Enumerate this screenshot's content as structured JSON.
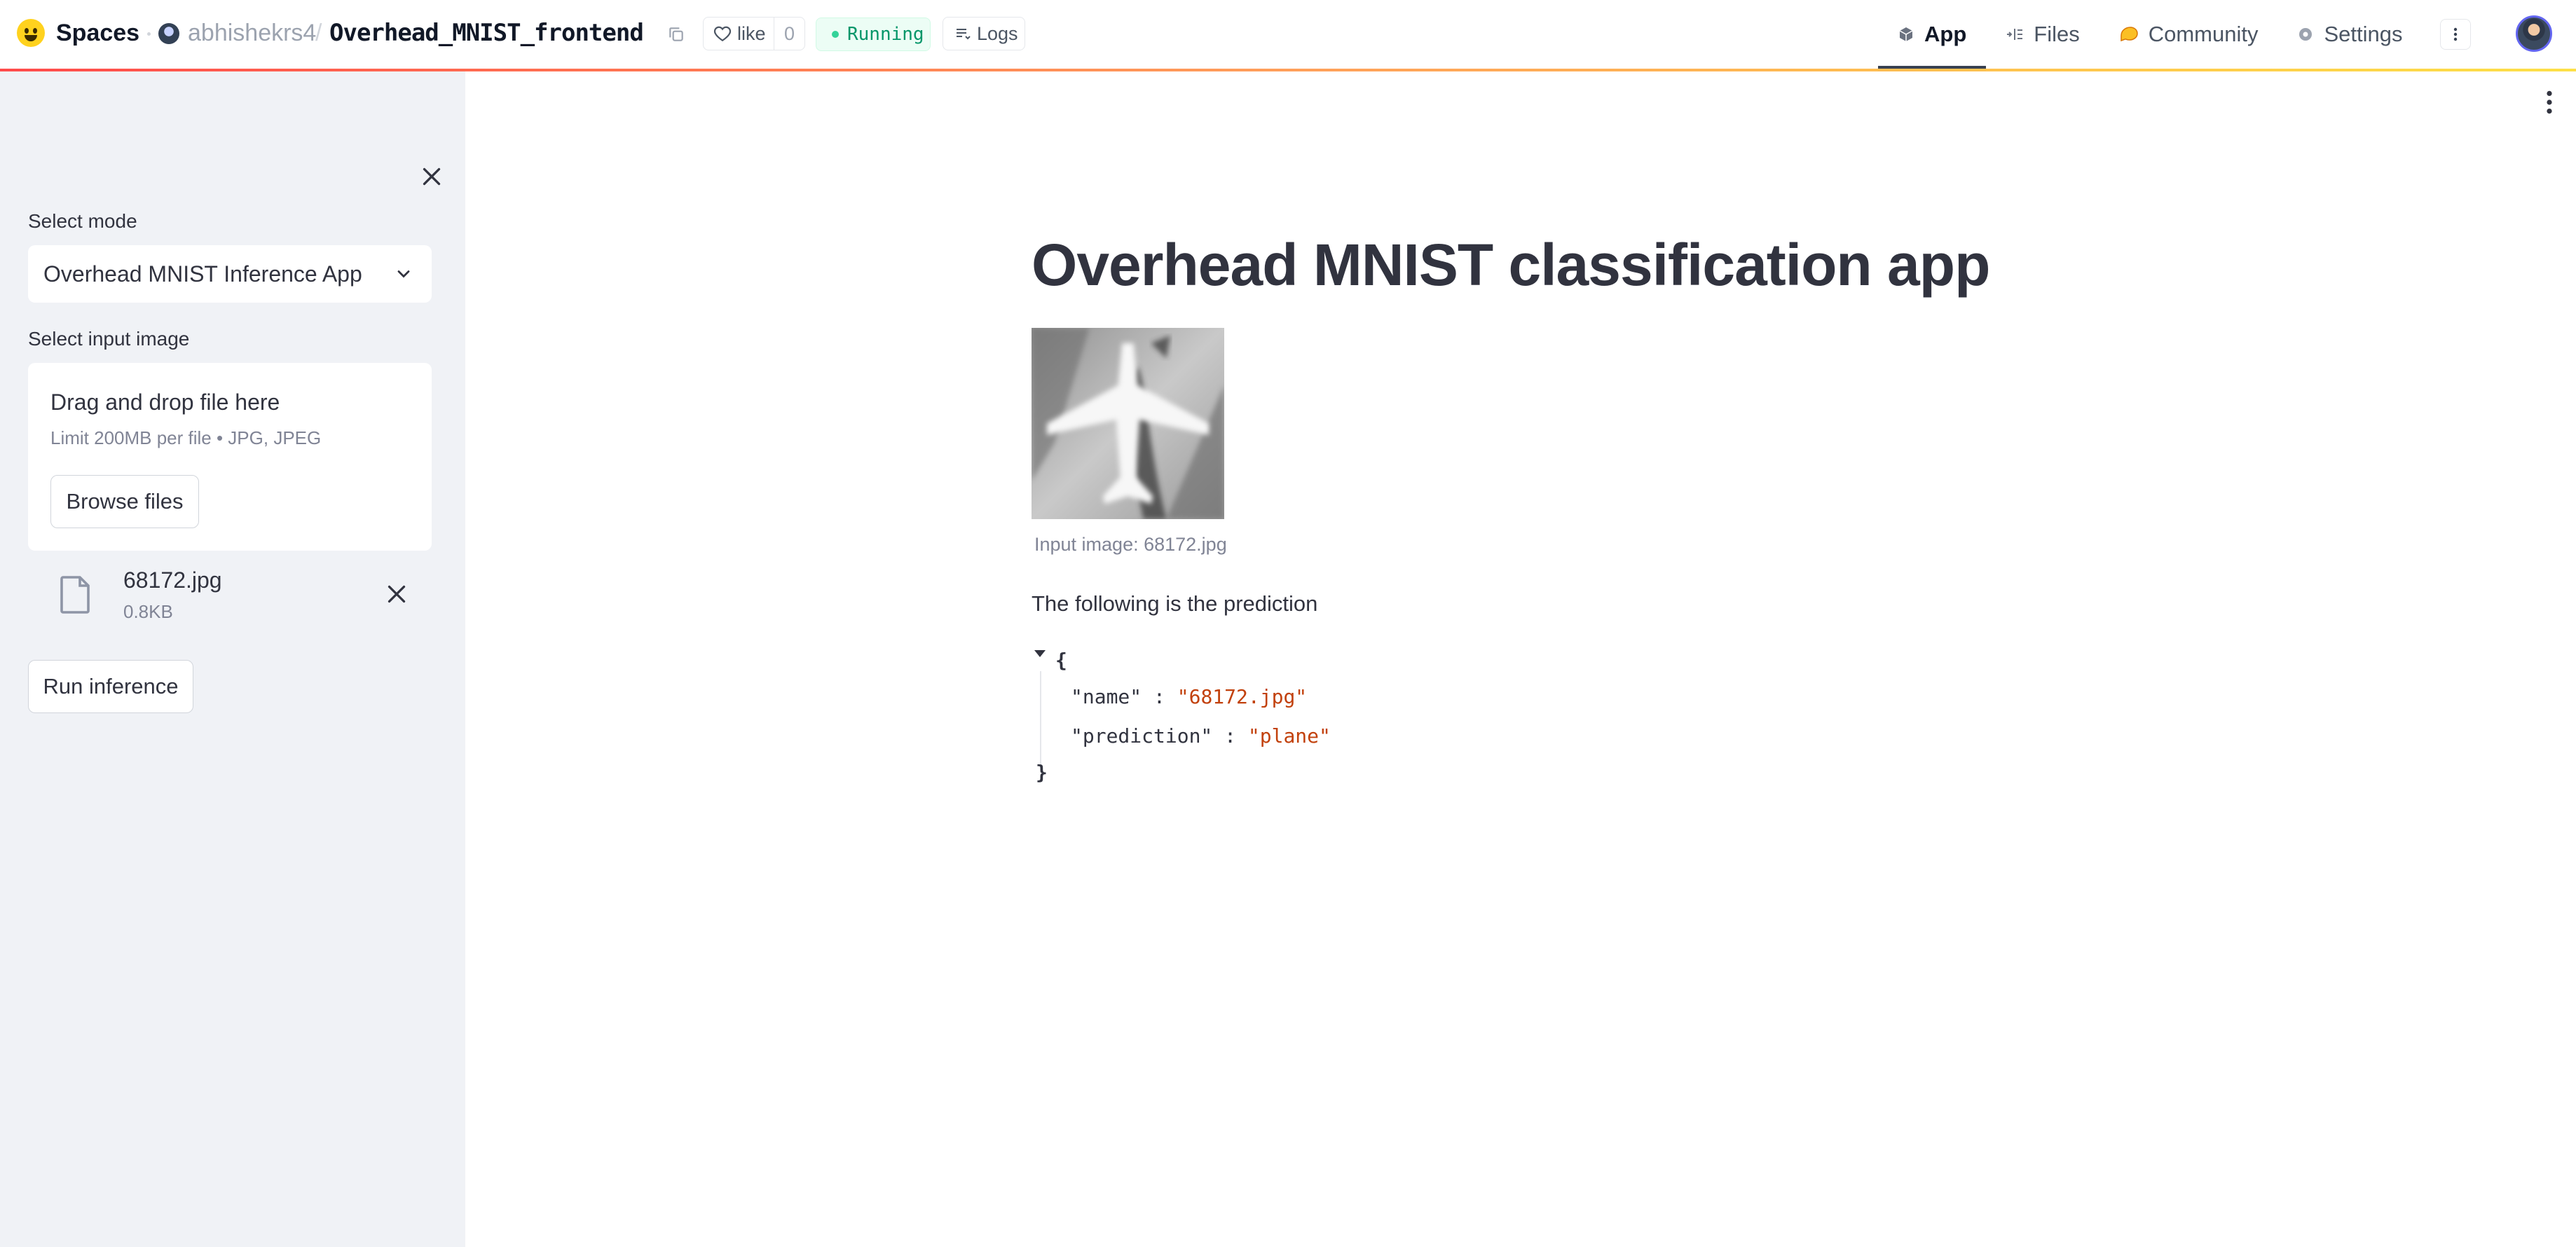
{
  "header": {
    "brand": "Spaces",
    "owner": "abhishekrs4",
    "separator": "/",
    "repo": "Overhead_MNIST_frontend",
    "like_label": "like",
    "like_count": "0",
    "status": "Running",
    "logs_label": "Logs",
    "tabs": [
      {
        "label": "App",
        "icon": "cube-icon",
        "active": true
      },
      {
        "label": "Files",
        "icon": "files-icon",
        "active": false
      },
      {
        "label": "Community",
        "icon": "community-icon",
        "active": false
      },
      {
        "label": "Settings",
        "icon": "gear-icon",
        "active": false
      }
    ],
    "accent_gradient": [
      "#ff4b4b",
      "#ff9f5a",
      "#fde047"
    ]
  },
  "sidebar": {
    "mode_label": "Select mode",
    "mode_value": "Overhead MNIST Inference App",
    "input_label": "Select input image",
    "dropzone_title": "Drag and drop file here",
    "dropzone_limit": "Limit 200MB per file • JPG, JPEG",
    "browse_label": "Browse files",
    "file": {
      "name": "68172.jpg",
      "size": "0.8KB"
    },
    "run_label": "Run inference"
  },
  "main": {
    "title": "Overhead MNIST classification app",
    "image_caption": "Input image: 68172.jpg",
    "prediction_intro": "The following is the prediction",
    "json": {
      "open": "{",
      "close": "}",
      "rows": [
        {
          "key": "\"name\"",
          "sep": ":",
          "value": "\"68172.jpg\""
        },
        {
          "key": "\"prediction\"",
          "sep": ":",
          "value": "\"plane\""
        }
      ]
    }
  }
}
